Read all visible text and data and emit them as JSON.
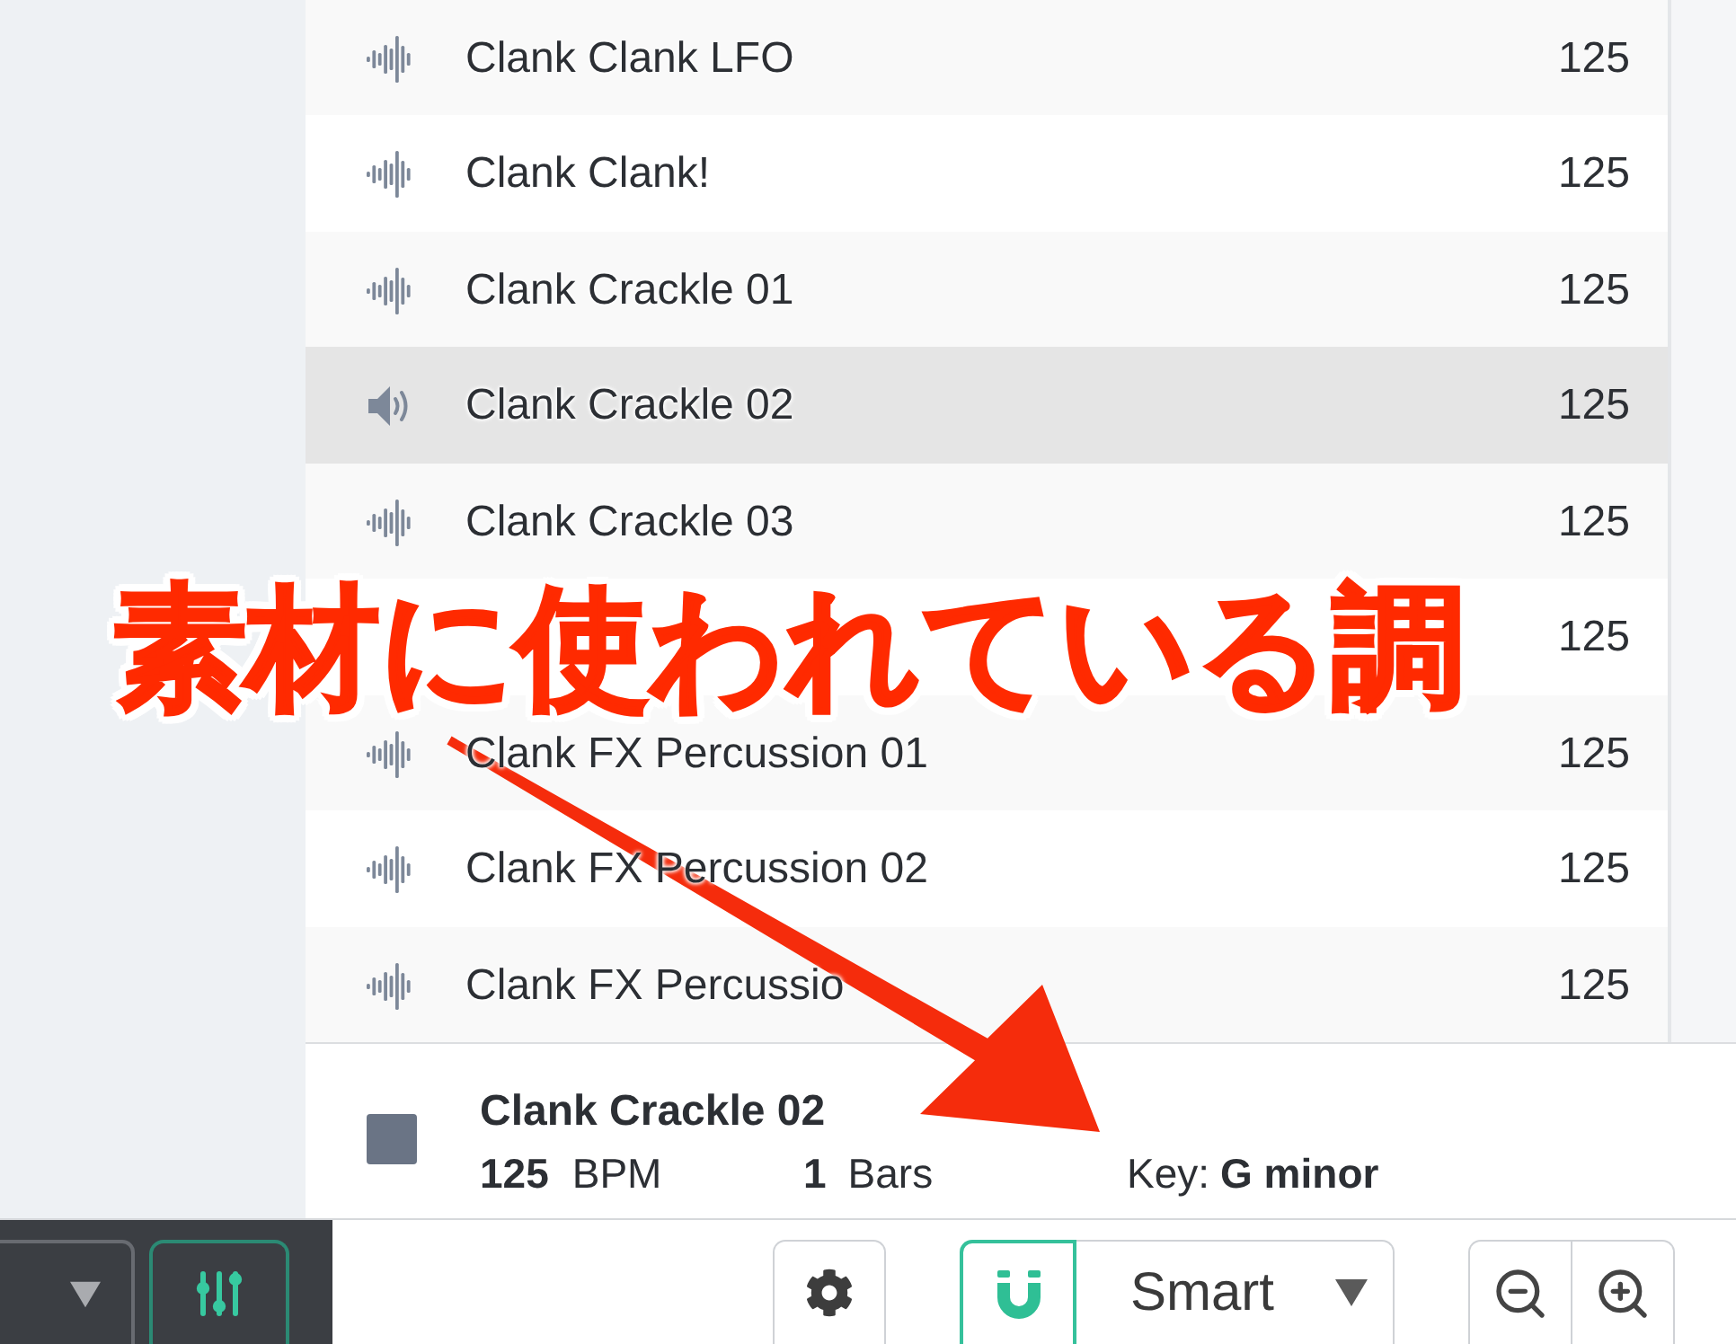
{
  "loops": [
    {
      "name": "Clank Clank LFO",
      "tempo": "125",
      "selected": false
    },
    {
      "name": "Clank Clank!",
      "tempo": "125",
      "selected": false
    },
    {
      "name": "Clank Crackle 01",
      "tempo": "125",
      "selected": false
    },
    {
      "name": "Clank Crackle 02",
      "tempo": "125",
      "selected": true
    },
    {
      "name": "Clank Crackle 03",
      "tempo": "125",
      "selected": false
    },
    {
      "tempo": "125",
      "selected": false
    },
    {
      "name": "Clank FX Percussion 01",
      "tempo": "125",
      "selected": false
    },
    {
      "name": "Clank FX Percussion 02",
      "tempo": "125",
      "selected": false
    },
    {
      "name": "Clank FX Percussio",
      "tempo": "125",
      "selected": false
    }
  ],
  "preview": {
    "name": "Clank Crackle 02",
    "tempo": "125",
    "tempo_unit": "BPM",
    "bars": "1",
    "bars_unit": "Bars",
    "key_label": "Key:",
    "key": "G minor"
  },
  "toolbar": {
    "snap": {
      "on": true,
      "mode": "Smart"
    }
  },
  "annotation": {
    "text": "素材に使われている調"
  }
}
